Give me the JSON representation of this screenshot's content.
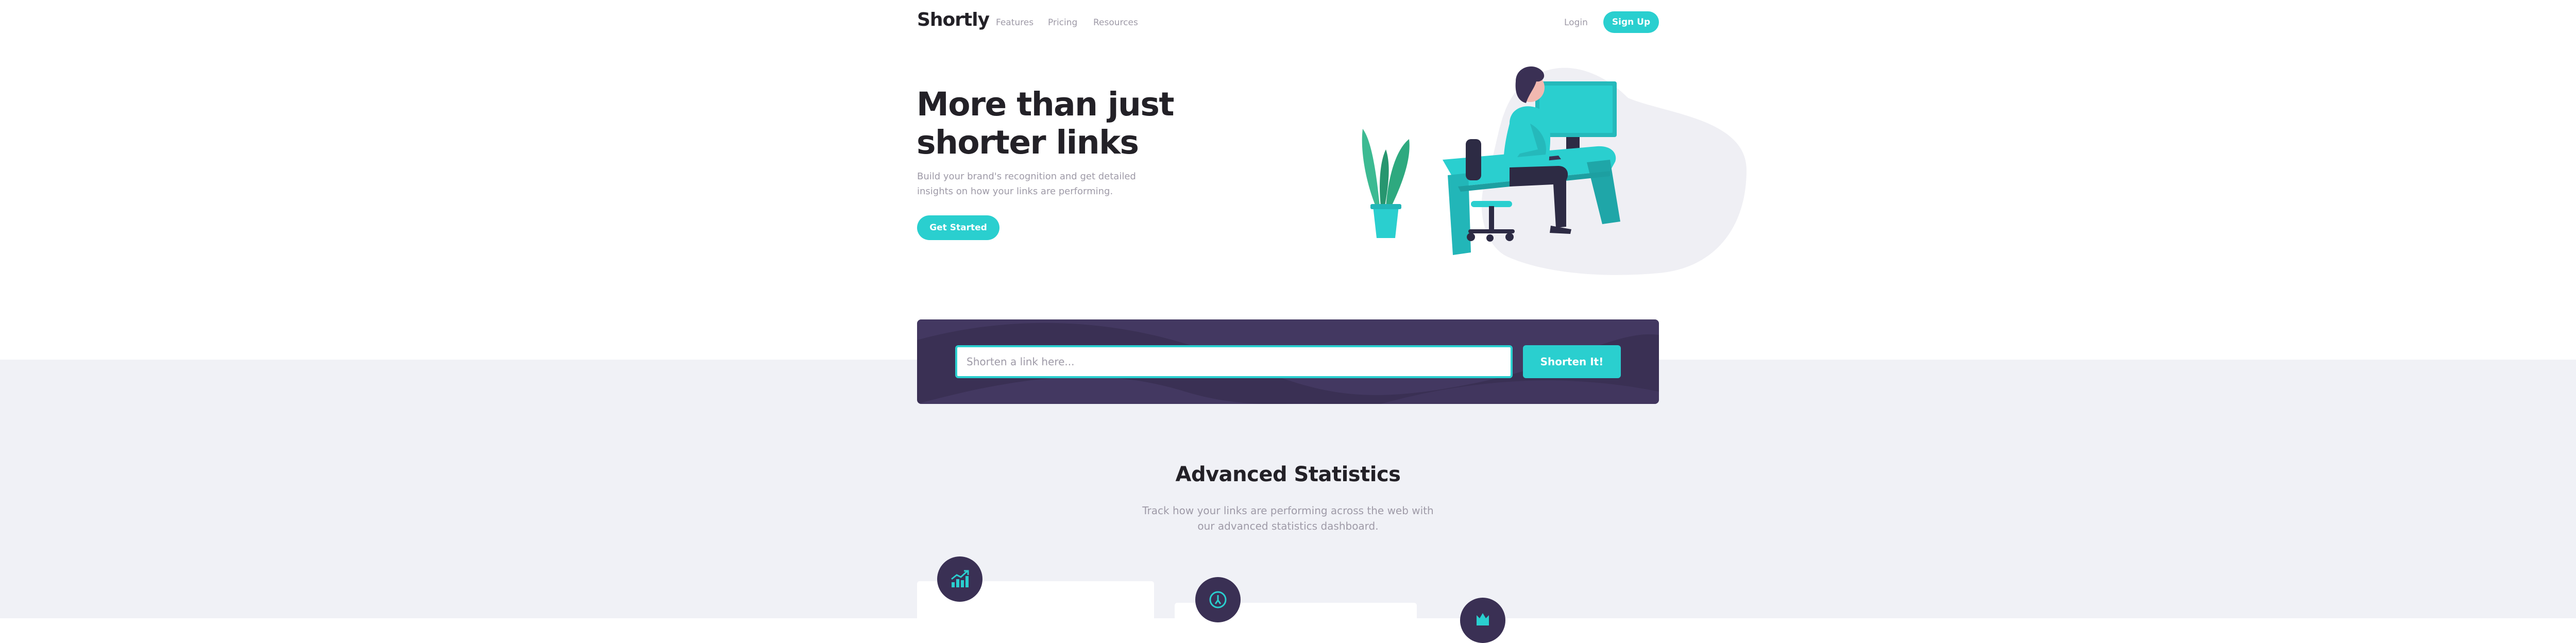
{
  "nav": {
    "logo": "Shortly",
    "links": [
      "Features",
      "Pricing",
      "Resources"
    ],
    "login": "Login",
    "signup": "Sign Up"
  },
  "hero": {
    "title": "More than just shorter links",
    "subtitle": "Build your brand's recognition and get detailed insights on how your links are performing.",
    "cta": "Get Started"
  },
  "shorten": {
    "placeholder": "Shorten a link here...",
    "button": "Shorten It!"
  },
  "stats": {
    "title": "Advanced Statistics",
    "subtitle": "Track how your links are performing across the web with our advanced statistics dashboard.",
    "cards": [
      {
        "icon": "brand-recognition-icon"
      },
      {
        "icon": "detailed-records-icon"
      },
      {
        "icon": "fully-customizable-icon"
      }
    ]
  },
  "colors": {
    "primary": "#2acfcf",
    "dark_violet": "#3a3054",
    "gray_bg": "#f0f1f6",
    "text_gray": "#9e9aa7",
    "text_dark": "#232127"
  }
}
